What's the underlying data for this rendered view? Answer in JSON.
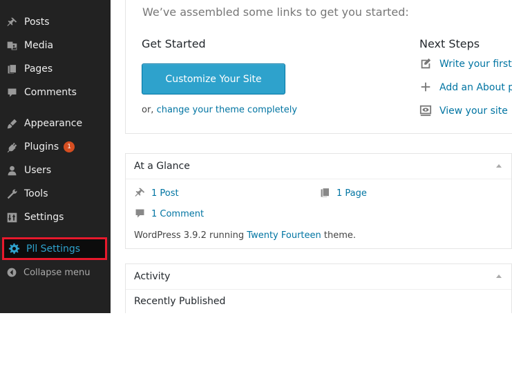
{
  "sidebar": {
    "items": [
      {
        "label": "Posts",
        "icon": "pushpin-icon"
      },
      {
        "label": "Media",
        "icon": "media-icon"
      },
      {
        "label": "Pages",
        "icon": "pages-icon"
      },
      {
        "label": "Comments",
        "icon": "comment-icon"
      },
      {
        "label": "Appearance",
        "icon": "paintbrush-icon"
      },
      {
        "label": "Plugins",
        "icon": "plugin-icon",
        "badge": "1"
      },
      {
        "label": "Users",
        "icon": "user-icon"
      },
      {
        "label": "Tools",
        "icon": "wrench-icon"
      },
      {
        "label": "Settings",
        "icon": "settings-sliders-icon"
      }
    ],
    "pll_settings": {
      "label": "Pll Settings",
      "icon": "gear-icon",
      "highlight_color": "#e8192c"
    },
    "collapse": {
      "label": "Collapse menu",
      "icon": "collapse-arrow-icon"
    }
  },
  "welcome": {
    "intro": "We’ve assembled some links to get you started:",
    "get_started": {
      "heading": "Get Started",
      "button_label": "Customize Your Site",
      "or_prefix": "or, ",
      "change_theme_link": "change your theme completely"
    },
    "next_steps": {
      "heading": "Next Steps",
      "items": [
        {
          "label": "Write your first",
          "icon": "edit-icon"
        },
        {
          "label": "Add an About p",
          "icon": "plus-icon"
        },
        {
          "label": "View your site",
          "icon": "view-site-icon"
        }
      ]
    }
  },
  "glance": {
    "title": "At a Glance",
    "posts": "1 Post",
    "pages": "1 Page",
    "comments": "1 Comment",
    "version_prefix": "WordPress 3.9.2 running ",
    "theme_link": "Twenty Fourteen",
    "version_suffix": " theme."
  },
  "activity": {
    "title": "Activity",
    "recently_published": "Recently Published"
  },
  "colors": {
    "sidebar_bg": "#222222",
    "accent": "#2ea2cc",
    "link": "#0074a2",
    "badge": "#d54e21"
  }
}
